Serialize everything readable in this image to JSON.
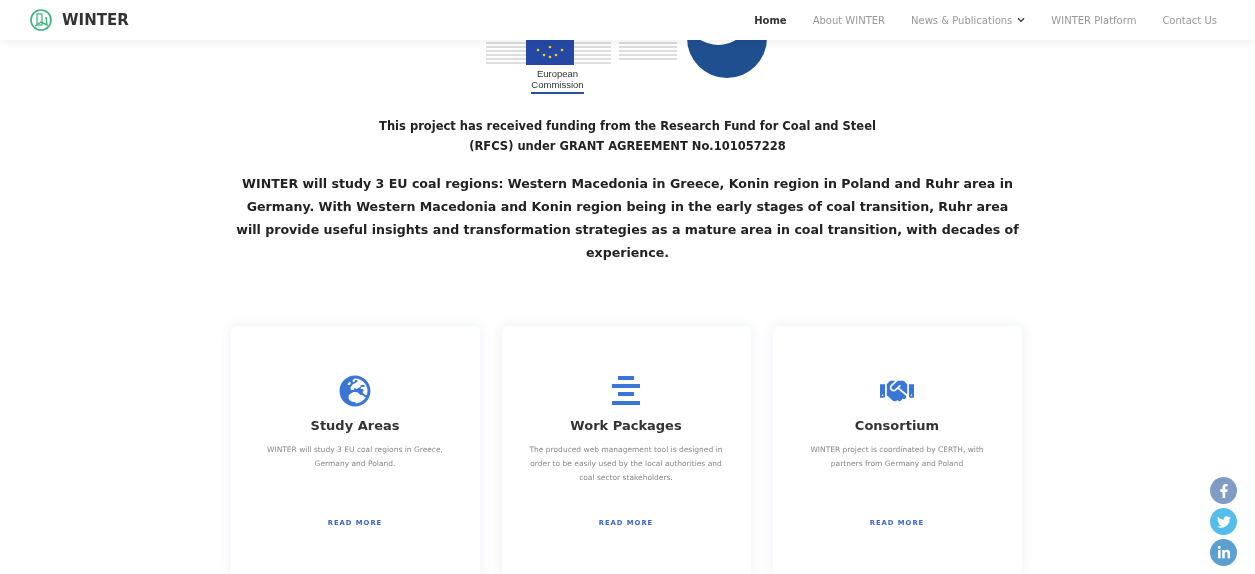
{
  "brand": {
    "name": "WINTER"
  },
  "nav": [
    {
      "label": "Home",
      "selected": true,
      "dropdown": false
    },
    {
      "label": "About WINTER",
      "selected": false,
      "dropdown": false
    },
    {
      "label": "News & Publications",
      "selected": false,
      "dropdown": true
    },
    {
      "label": "WINTER Platform",
      "selected": false,
      "dropdown": false
    },
    {
      "label": "Contact Us",
      "selected": false,
      "dropdown": false
    }
  ],
  "logos": {
    "eu_caption": [
      "European",
      "Commission"
    ]
  },
  "funding": [
    "This project has received funding from the Research Fund for Coal and Steel",
    "(RFCS) under GRANT AGREEMENT No.101057228"
  ],
  "intro": "WINTER will study 3 EU coal regions: Western Macedonia in Greece, Konin region in Poland and Ruhr area in Germany. With Western Macedonia and Konin region being in the early stages of coal transition, Ruhr area will provide useful insights and transformation strategies as a mature area in coal transition, with decades of experience.",
  "cards": [
    {
      "kind": "globe",
      "title": "Study Areas",
      "text": "WINTER will study 3 EU coal regions in Greece, Germany and Poland.",
      "link": "READ MORE"
    },
    {
      "kind": "bars",
      "title": "Work Packages",
      "text": "The produced web management tool is designed in order to be easily used by the local authorities and coal sector stakeholders.",
      "link": "READ MORE"
    },
    {
      "kind": "handshake",
      "title": "Consortium",
      "text": "WINTER project is coordinated by CERTH, with partners from Germany and Poland",
      "link": "READ MORE"
    }
  ],
  "social": [
    {
      "kind": "facebook",
      "color": "#7f9cc4"
    },
    {
      "kind": "twitter",
      "color": "#55bde9"
    },
    {
      "kind": "linkedin",
      "color": "#5c9fd1"
    }
  ]
}
